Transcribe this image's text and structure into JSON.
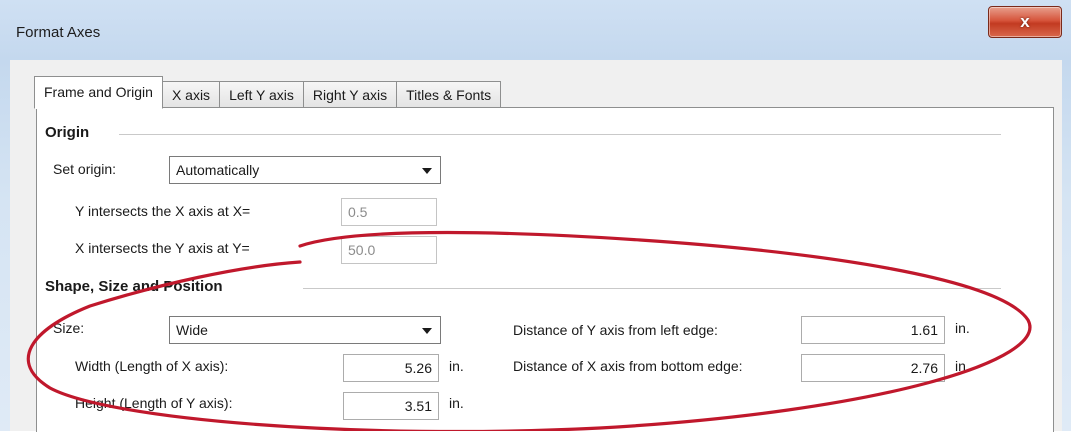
{
  "window": {
    "title": "Format Axes",
    "close_glyph": "x"
  },
  "tabs": [
    {
      "label": "Frame and Origin",
      "active": true
    },
    {
      "label": "X axis",
      "active": false
    },
    {
      "label": "Left Y axis",
      "active": false
    },
    {
      "label": "Right Y axis",
      "active": false
    },
    {
      "label": "Titles & Fonts",
      "active": false
    }
  ],
  "origin": {
    "title": "Origin",
    "set_origin_label": "Set origin:",
    "set_origin_value": "Automatically",
    "y_intersects_label": "Y intersects the X axis at X=",
    "y_intersects_value": "0.5",
    "x_intersects_label": "X intersects the Y axis at Y=",
    "x_intersects_value": "50.0"
  },
  "shape": {
    "title": "Shape, Size and Position",
    "size_label": "Size:",
    "size_value": "Wide",
    "width_label": "Width (Length of X axis):",
    "width_value": "5.26",
    "width_unit": "in.",
    "height_label": "Height (Length of Y axis):",
    "height_value": "3.51",
    "height_unit": "in.",
    "y_dist_label": "Distance of Y axis from left edge:",
    "y_dist_value": "1.61",
    "y_dist_unit": "in.",
    "x_dist_label": "Distance of X axis from bottom edge:",
    "x_dist_value": "2.76",
    "x_dist_unit": "in."
  },
  "colors": {
    "annotation_ellipse": "#c0182c",
    "close_button": "#c9452b"
  }
}
